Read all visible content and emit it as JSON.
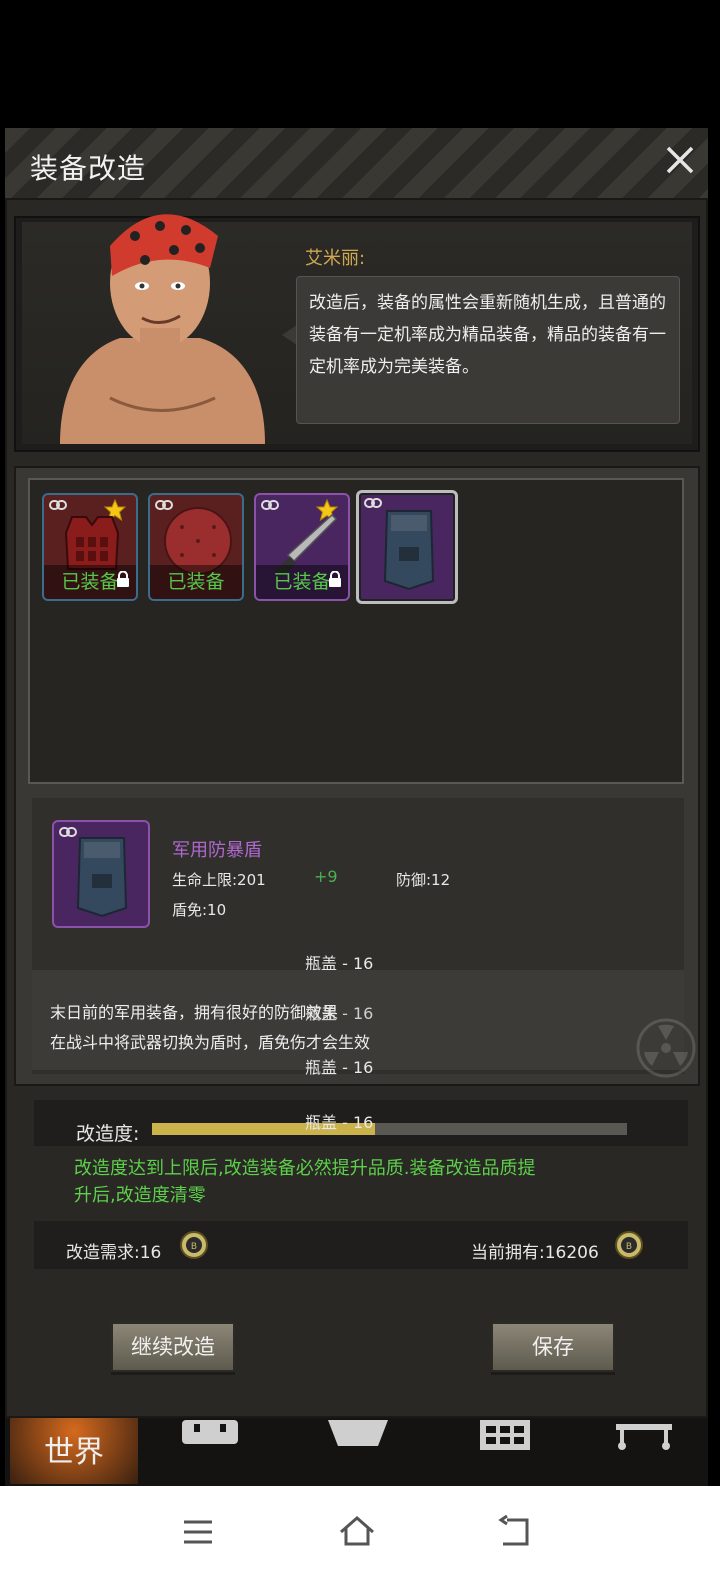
{
  "dialog": {
    "title": "装备改造",
    "close_icon": "close-icon"
  },
  "npc": {
    "name": "艾米丽:",
    "speech": "改造后，装备的属性会重新随机生成，且普通的装备有一定机率成为精品装备，精品的装备有一定机率成为完美装备。"
  },
  "inventory": {
    "items": [
      {
        "icon": "armor-vest-icon",
        "rarity": "red",
        "equipped_label": "已装备",
        "starred": true,
        "locked": true
      },
      {
        "icon": "round-shield-icon",
        "rarity": "red",
        "equipped_label": "已装备",
        "starred": false,
        "locked": false
      },
      {
        "icon": "machete-icon",
        "rarity": "purple",
        "equipped_label": "已装备",
        "starred": true,
        "locked": true
      },
      {
        "icon": "riot-shield-icon",
        "rarity": "purple",
        "equipped_label": "",
        "starred": false,
        "locked": false,
        "selected": true
      }
    ]
  },
  "detail": {
    "name": "军用防暴盾",
    "hp_label": "生命上限:201",
    "hp_bonus": "+9",
    "defense_label": "防御:12",
    "shield_label": "盾免:10",
    "desc_line1": "末日前的军用装备，拥有很好的防御效果",
    "desc_line2": "在战斗中将武器切换为盾时，盾免伤才会生效",
    "bottle_caps": [
      "瓶盖 - 16",
      "瓶盖 - 16",
      "瓶盖 - 16",
      "瓶盖 - 16"
    ]
  },
  "modify": {
    "progress_label": "改造度:",
    "progress_fraction": 0.47,
    "note_line1": "改造度达到上限后,改造装备必然提升品质.装备改造品质提",
    "note_line2": "升后,改造度清零",
    "requirement": "改造需求:16",
    "owned": "当前拥有:16206",
    "coin_icon": "bottle-cap-icon"
  },
  "buttons": {
    "continue": "继续改造",
    "save": "保存"
  },
  "bottom_nav": {
    "world": "世界"
  },
  "colors": {
    "equipped_green": "#55c84a",
    "epic_purple": "#b068d0",
    "note_green": "#5cd04a",
    "npc_name_gold": "#cfa850",
    "progress_gold": "#c9b34a"
  }
}
